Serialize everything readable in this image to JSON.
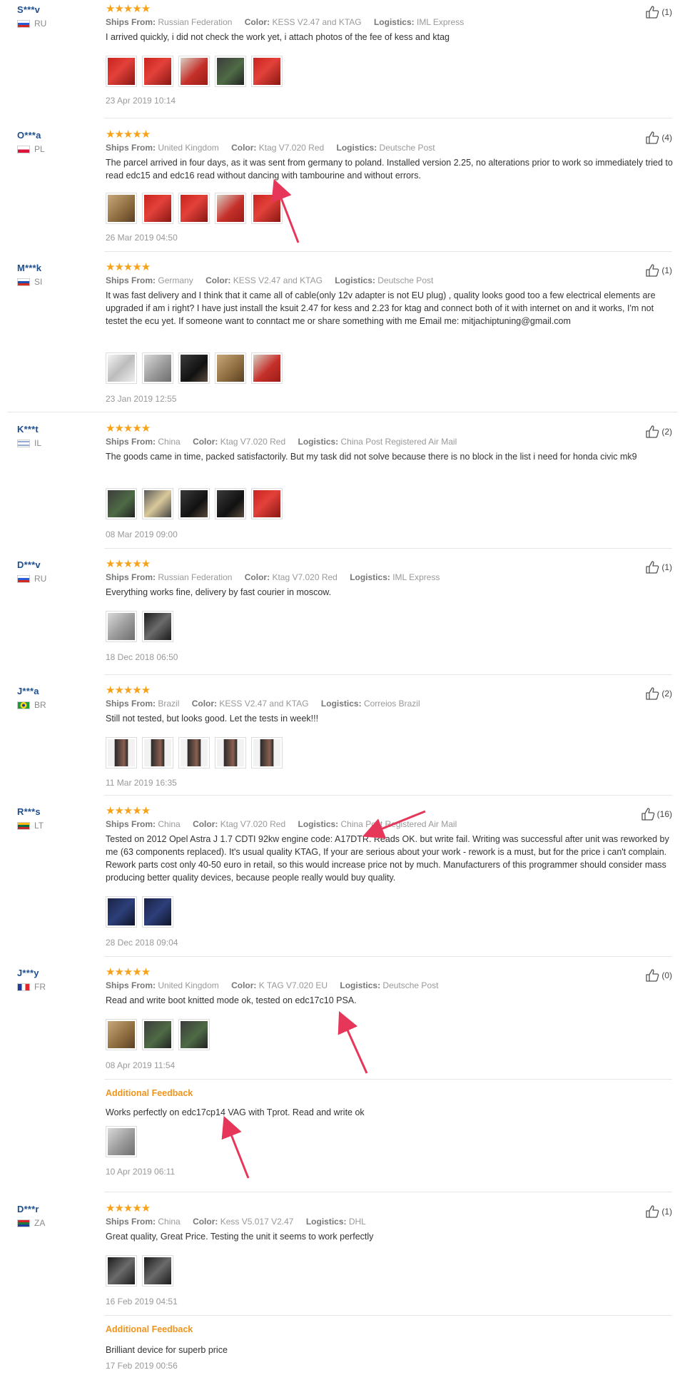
{
  "like_icon": "thumbs-up-icon",
  "star_icon": "star-icon",
  "stars": "★★★★★",
  "labels": {
    "ships_from": "Ships From:",
    "color": "Color:",
    "logistics": "Logistics:",
    "additional_feedback": "Additional Feedback"
  },
  "colors": {
    "star": "#f7a21b",
    "username": "#1f4f8f",
    "additional_feedback": "#f0941c",
    "annotation_arrow": "#e6375a"
  },
  "reviews": [
    {
      "user": "S***v",
      "country": "RU",
      "flag": "russia-flag-icon",
      "ships_from": "Russian Federation",
      "color": "KESS V2.47 and KTAG",
      "logistics": "IML Express",
      "text": "I arrived quickly, i did not check the work yet, i attach photos of the fee of kess and ktag",
      "photo_count": 5,
      "date": "23 Apr 2019 10:14",
      "likes": "(1)"
    },
    {
      "user": "O***a",
      "country": "PL",
      "flag": "poland-flag-icon",
      "ships_from": "United Kingdom",
      "color": "Ktag V7.020 Red",
      "logistics": "Deutsche Post",
      "text": "The parcel arrived in four days, as it was sent from germany to poland. Installed version 2.25, no alterations prior to work so immediately tried to read edc15 and edc16 read without dancing with tambourine and without errors.",
      "photo_count": 5,
      "date": "26 Mar 2019 04:50",
      "likes": "(4)"
    },
    {
      "user": "M***k",
      "country": "SI",
      "flag": "slovenia-flag-icon",
      "ships_from": "Germany",
      "color": "KESS V2.47 and KTAG",
      "logistics": "Deutsche Post",
      "text": "It was fast delivery and I think that it came all of cable(only 12v adapter is not EU plug) , quality looks good too a few electrical elements are upgraded if am i right? I have just install the ksuit 2.47 for kess and 2.23 for ktag and connect both of it with internet on and it works, I'm not testet the ecu yet. If someone want to conntact me or share something with me Email me: mitjachiptuning@gmail.com",
      "photo_count": 5,
      "date": "23 Jan 2019 12:55",
      "likes": "(1)"
    },
    {
      "user": "K***t",
      "country": "IL",
      "flag": "israel-flag-icon",
      "ships_from": "China",
      "color": "Ktag V7.020 Red",
      "logistics": "China Post Registered Air Mail",
      "text": "The goods came in time, packed satisfactorily. But my task did not solve because there is no block in the list i need for honda civic mk9",
      "photo_count": 5,
      "date": "08 Mar 2019 09:00",
      "likes": "(2)"
    },
    {
      "user": "D***v",
      "country": "RU",
      "flag": "russia-flag-icon",
      "ships_from": "Russian Federation",
      "color": "Ktag V7.020 Red",
      "logistics": "IML Express",
      "text": "Everything works fine, delivery by fast courier in moscow.",
      "photo_count": 2,
      "date": "18 Dec 2018 06:50",
      "likes": "(1)"
    },
    {
      "user": "J***a",
      "country": "BR",
      "flag": "brazil-flag-icon",
      "ships_from": "Brazil",
      "color": "KESS V2.47 and KTAG",
      "logistics": "Correios Brazil",
      "text": "Still not tested, but looks good. Let the tests in week!!!",
      "photo_count": 5,
      "date": "11 Mar 2019 16:35",
      "likes": "(2)"
    },
    {
      "user": "R***s",
      "country": "LT",
      "flag": "lithuania-flag-icon",
      "ships_from": "China",
      "color": "Ktag V7.020 Red",
      "logistics": "China Post Registered Air Mail",
      "text": "Tested on 2012 Opel Astra J 1.7 CDTI 92kw engine code: A17DTR. Reads OK. but write fail. Writing was successful after unit was reworked by me (63 components replaced). It's usual quality KTAG, If your are serious about your work - rework is a must, but for the price i can't complain. Rework parts cost only 40-50 euro in retail, so this would increase price not by much. Manufacturers of this programmer should consider mass producing better quality devices, because people really would buy quality.",
      "photo_count": 2,
      "date": "28 Dec 2018 09:04",
      "likes": "(16)"
    },
    {
      "user": "J***y",
      "country": "FR",
      "flag": "france-flag-icon",
      "ships_from": "United Kingdom",
      "color": "K TAG V7.020 EU",
      "logistics": "Deutsche Post",
      "text": "Read and write boot knitted mode ok, tested on edc17c10 PSA.",
      "photo_count": 3,
      "date": "08 Apr 2019 11:54",
      "likes": "(0)",
      "additional": {
        "text": "Works perfectly on edc17cp14 VAG with Tprot. Read and write ok",
        "photo_count": 1,
        "date": "10 Apr 2019 06:11"
      }
    },
    {
      "user": "D***r",
      "country": "ZA",
      "flag": "south-africa-flag-icon",
      "ships_from": "China",
      "color": "Kess V5.017 V2.47",
      "logistics": "DHL",
      "text": "Great quality, Great Price. Testing the unit it seems to work perfectly",
      "photo_count": 2,
      "date": "16 Feb 2019 04:51",
      "likes": "(1)",
      "additional": {
        "text": "Brilliant device for superb price",
        "photo_count": 0,
        "date": "17 Feb 2019 00:56"
      }
    }
  ]
}
